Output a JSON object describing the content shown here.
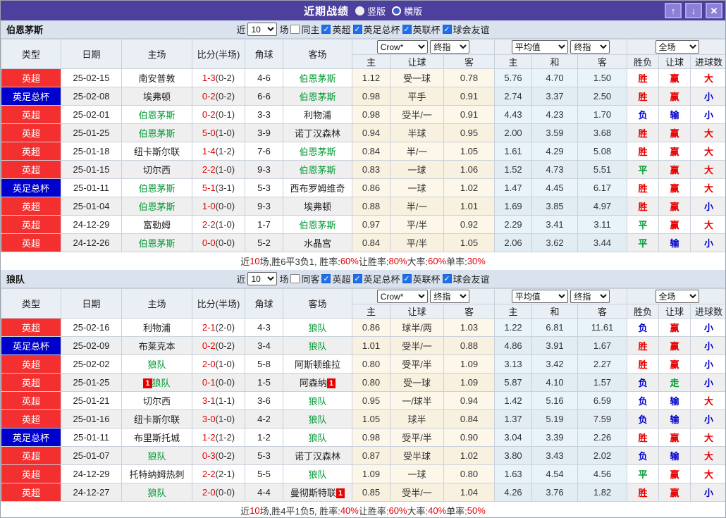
{
  "title_bar": {
    "title": "近期战绩",
    "vertical_label": "竖版",
    "horizontal_label": "横版",
    "up_button": "↑",
    "down_button": "↓",
    "close_button": "✕"
  },
  "filters": {
    "near": "近",
    "count": "10",
    "games": "场",
    "leagues": [
      "英超",
      "英足总杯",
      "英联杯",
      "球会友谊"
    ]
  },
  "table": {
    "left_headers": [
      "类型",
      "日期",
      "主场",
      "比分(半场)",
      "角球",
      "客场"
    ],
    "crow_select": "Crow*",
    "final_select": "终指",
    "avg_select": "平均值",
    "full_select": "全场",
    "crow_subheaders": [
      "主",
      "让球",
      "客"
    ],
    "avg_subheaders": [
      "主",
      "和",
      "客"
    ],
    "result_subheaders": [
      "胜负",
      "让球",
      "进球数"
    ]
  },
  "colors": {
    "type": {
      "英超": "#f42f2f",
      "英足总杯": "#0000cc"
    },
    "values": {
      "胜": "#e60000",
      "平": "#009933",
      "负": "#0000cc",
      "赢": "#e60000",
      "走": "#009933",
      "输": "#0000cc",
      "大": "#e60000",
      "小": "#0000cc"
    }
  },
  "sections": [
    {
      "team": "伯恩茅斯",
      "same_side_label": "同主",
      "rows": [
        {
          "type": "英超",
          "date": "25-02-15",
          "home": "南安普敦",
          "score": "1-3",
          "half": "(0-2)",
          "corner": "4-6",
          "away": "伯恩茅斯",
          "crow": [
            "1.12",
            "受一球",
            "0.78"
          ],
          "avg": [
            "5.76",
            "4.70",
            "1.50"
          ],
          "results": [
            "胜",
            "赢",
            "大"
          ]
        },
        {
          "type": "英足总杯",
          "date": "25-02-08",
          "home": "埃弗顿",
          "score": "0-2",
          "half": "(0-2)",
          "corner": "6-6",
          "away": "伯恩茅斯",
          "crow": [
            "0.98",
            "平手",
            "0.91"
          ],
          "avg": [
            "2.74",
            "3.37",
            "2.50"
          ],
          "results": [
            "胜",
            "赢",
            "小"
          ]
        },
        {
          "type": "英超",
          "date": "25-02-01",
          "home": "伯恩茅斯",
          "score": "0-2",
          "half": "(0-1)",
          "corner": "3-3",
          "away": "利物浦",
          "crow": [
            "0.98",
            "受半/一",
            "0.91"
          ],
          "avg": [
            "4.43",
            "4.23",
            "1.70"
          ],
          "results": [
            "负",
            "输",
            "小"
          ]
        },
        {
          "type": "英超",
          "date": "25-01-25",
          "home": "伯恩茅斯",
          "score": "5-0",
          "half": "(1-0)",
          "corner": "3-9",
          "away": "诺丁汉森林",
          "crow": [
            "0.94",
            "半球",
            "0.95"
          ],
          "avg": [
            "2.00",
            "3.59",
            "3.68"
          ],
          "results": [
            "胜",
            "赢",
            "大"
          ]
        },
        {
          "type": "英超",
          "date": "25-01-18",
          "home": "纽卡斯尔联",
          "score": "1-4",
          "half": "(1-2)",
          "corner": "7-6",
          "away": "伯恩茅斯",
          "crow": [
            "0.84",
            "半/一",
            "1.05"
          ],
          "avg": [
            "1.61",
            "4.29",
            "5.08"
          ],
          "results": [
            "胜",
            "赢",
            "大"
          ]
        },
        {
          "type": "英超",
          "date": "25-01-15",
          "home": "切尔西",
          "score": "2-2",
          "half": "(1-0)",
          "corner": "9-3",
          "away": "伯恩茅斯",
          "crow": [
            "0.83",
            "一球",
            "1.06"
          ],
          "avg": [
            "1.52",
            "4.73",
            "5.51"
          ],
          "results": [
            "平",
            "赢",
            "大"
          ]
        },
        {
          "type": "英足总杯",
          "date": "25-01-11",
          "home": "伯恩茅斯",
          "score": "5-1",
          "half": "(3-1)",
          "corner": "5-3",
          "away": "西布罗姆维奇",
          "crow": [
            "0.86",
            "一球",
            "1.02"
          ],
          "avg": [
            "1.47",
            "4.45",
            "6.17"
          ],
          "results": [
            "胜",
            "赢",
            "大"
          ]
        },
        {
          "type": "英超",
          "date": "25-01-04",
          "home": "伯恩茅斯",
          "score": "1-0",
          "half": "(0-0)",
          "corner": "9-3",
          "away": "埃弗顿",
          "crow": [
            "0.88",
            "半/一",
            "1.01"
          ],
          "avg": [
            "1.69",
            "3.85",
            "4.97"
          ],
          "results": [
            "胜",
            "赢",
            "小"
          ]
        },
        {
          "type": "英超",
          "date": "24-12-29",
          "home": "富勒姆",
          "score": "2-2",
          "half": "(1-0)",
          "corner": "1-7",
          "away": "伯恩茅斯",
          "crow": [
            "0.97",
            "平/半",
            "0.92"
          ],
          "avg": [
            "2.29",
            "3.41",
            "3.11"
          ],
          "results": [
            "平",
            "赢",
            "大"
          ]
        },
        {
          "type": "英超",
          "date": "24-12-26",
          "home": "伯恩茅斯",
          "score": "0-0",
          "half": "(0-0)",
          "corner": "5-2",
          "away": "水晶宫",
          "crow": [
            "0.84",
            "平/半",
            "1.05"
          ],
          "avg": [
            "2.06",
            "3.62",
            "3.44"
          ],
          "results": [
            "平",
            "输",
            "小"
          ]
        }
      ],
      "summary": [
        {
          "text": "近",
          "red": false
        },
        {
          "text": "10",
          "red": true
        },
        {
          "text": "场,胜6平3负1, 胜率:",
          "red": false
        },
        {
          "text": "60%",
          "red": true
        },
        {
          "text": " 让胜率:",
          "red": false
        },
        {
          "text": "80%",
          "red": true
        },
        {
          "text": " 大率:",
          "red": false
        },
        {
          "text": "60%",
          "red": true
        },
        {
          "text": " 单率:",
          "red": false
        },
        {
          "text": "30%",
          "red": true
        }
      ]
    },
    {
      "team": "狼队",
      "same_side_label": "同客",
      "rows": [
        {
          "type": "英超",
          "date": "25-02-16",
          "home": "利物浦",
          "score": "2-1",
          "half": "(2-0)",
          "corner": "4-3",
          "away": "狼队",
          "crow": [
            "0.86",
            "球半/两",
            "1.03"
          ],
          "avg": [
            "1.22",
            "6.81",
            "11.61"
          ],
          "results": [
            "负",
            "赢",
            "小"
          ]
        },
        {
          "type": "英足总杯",
          "date": "25-02-09",
          "home": "布莱克本",
          "score": "0-2",
          "half": "(0-2)",
          "corner": "3-4",
          "away": "狼队",
          "crow": [
            "1.01",
            "受半/一",
            "0.88"
          ],
          "avg": [
            "4.86",
            "3.91",
            "1.67"
          ],
          "results": [
            "胜",
            "赢",
            "小"
          ]
        },
        {
          "type": "英超",
          "date": "25-02-02",
          "home": "狼队",
          "score": "2-0",
          "half": "(1-0)",
          "corner": "5-8",
          "away": "阿斯顿维拉",
          "crow": [
            "0.80",
            "受平/半",
            "1.09"
          ],
          "avg": [
            "3.13",
            "3.42",
            "2.27"
          ],
          "results": [
            "胜",
            "赢",
            "小"
          ]
        },
        {
          "type": "英超",
          "date": "25-01-25",
          "home": "狼队",
          "home_badge": "1",
          "score": "0-1",
          "half": "(0-0)",
          "corner": "1-5",
          "away": "阿森纳",
          "away_badge": "1",
          "crow": [
            "0.80",
            "受一球",
            "1.09"
          ],
          "avg": [
            "5.87",
            "4.10",
            "1.57"
          ],
          "results": [
            "负",
            "走",
            "小"
          ]
        },
        {
          "type": "英超",
          "date": "25-01-21",
          "home": "切尔西",
          "score": "3-1",
          "half": "(1-1)",
          "corner": "3-6",
          "away": "狼队",
          "crow": [
            "0.95",
            "一/球半",
            "0.94"
          ],
          "avg": [
            "1.42",
            "5.16",
            "6.59"
          ],
          "results": [
            "负",
            "输",
            "大"
          ]
        },
        {
          "type": "英超",
          "date": "25-01-16",
          "home": "纽卡斯尔联",
          "score": "3-0",
          "half": "(1-0)",
          "corner": "4-2",
          "away": "狼队",
          "crow": [
            "1.05",
            "球半",
            "0.84"
          ],
          "avg": [
            "1.37",
            "5.19",
            "7.59"
          ],
          "results": [
            "负",
            "输",
            "小"
          ]
        },
        {
          "type": "英足总杯",
          "date": "25-01-11",
          "home": "布里斯托城",
          "score": "1-2",
          "half": "(1-2)",
          "corner": "1-2",
          "away": "狼队",
          "crow": [
            "0.98",
            "受平/半",
            "0.90"
          ],
          "avg": [
            "3.04",
            "3.39",
            "2.26"
          ],
          "results": [
            "胜",
            "赢",
            "大"
          ]
        },
        {
          "type": "英超",
          "date": "25-01-07",
          "home": "狼队",
          "score": "0-3",
          "half": "(0-2)",
          "corner": "5-3",
          "away": "诺丁汉森林",
          "crow": [
            "0.87",
            "受半球",
            "1.02"
          ],
          "avg": [
            "3.80",
            "3.43",
            "2.02"
          ],
          "results": [
            "负",
            "输",
            "大"
          ]
        },
        {
          "type": "英超",
          "date": "24-12-29",
          "home": "托特纳姆热刺",
          "score": "2-2",
          "half": "(2-1)",
          "corner": "5-5",
          "away": "狼队",
          "crow": [
            "1.09",
            "一球",
            "0.80"
          ],
          "avg": [
            "1.63",
            "4.54",
            "4.56"
          ],
          "results": [
            "平",
            "赢",
            "大"
          ]
        },
        {
          "type": "英超",
          "date": "24-12-27",
          "home": "狼队",
          "score": "2-0",
          "half": "(0-0)",
          "corner": "4-4",
          "away": "曼彻斯特联",
          "away_badge": "1",
          "crow": [
            "0.85",
            "受半/一",
            "1.04"
          ],
          "avg": [
            "4.26",
            "3.76",
            "1.82"
          ],
          "results": [
            "胜",
            "赢",
            "小"
          ]
        }
      ],
      "summary": [
        {
          "text": "近",
          "red": false
        },
        {
          "text": "10",
          "red": true
        },
        {
          "text": "场,胜4平1负5, 胜率:",
          "red": false
        },
        {
          "text": "40%",
          "red": true
        },
        {
          "text": " 让胜率:",
          "red": false
        },
        {
          "text": "60%",
          "red": true
        },
        {
          "text": " 大率:",
          "red": false
        },
        {
          "text": "40%",
          "red": true
        },
        {
          "text": " 单率:",
          "red": false
        },
        {
          "text": "50%",
          "red": true
        }
      ]
    }
  ]
}
